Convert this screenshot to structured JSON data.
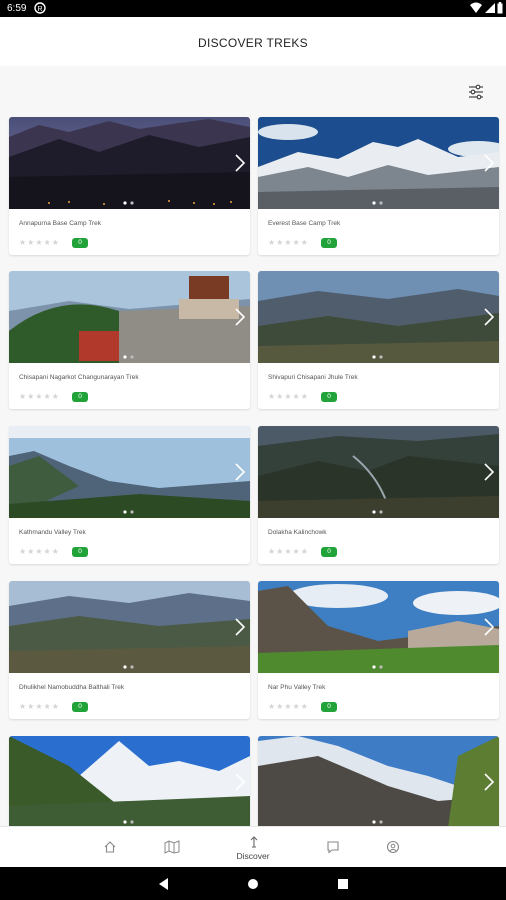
{
  "status_bar": {
    "time": "6:59"
  },
  "app_bar": {
    "title": "DISCOVER TREKS"
  },
  "treks": [
    {
      "name": "Annapurna Base Camp Trek",
      "rating_count": "0"
    },
    {
      "name": "Everest Base Camp Trek",
      "rating_count": "0"
    },
    {
      "name": "Chisapani Nagarkot Changunarayan Trek",
      "rating_count": "0"
    },
    {
      "name": "Shivapuri Chisapani Jhule Trek",
      "rating_count": "0"
    },
    {
      "name": "Kathmandu Valley Trek",
      "rating_count": "0"
    },
    {
      "name": "Dolakha Kalinchowk",
      "rating_count": "0"
    },
    {
      "name": "Dhulikhel Namobuddha Balthali Trek",
      "rating_count": "0"
    },
    {
      "name": "Nar Phu Valley Trek",
      "rating_count": "0"
    },
    {
      "name": "",
      "rating_count": ""
    },
    {
      "name": "",
      "rating_count": ""
    }
  ],
  "rating_stars": "★★★★★",
  "bottom_nav": {
    "discover_label": "Discover"
  },
  "colors": {
    "badge": "#22a33a",
    "accent": "#22a33a"
  }
}
